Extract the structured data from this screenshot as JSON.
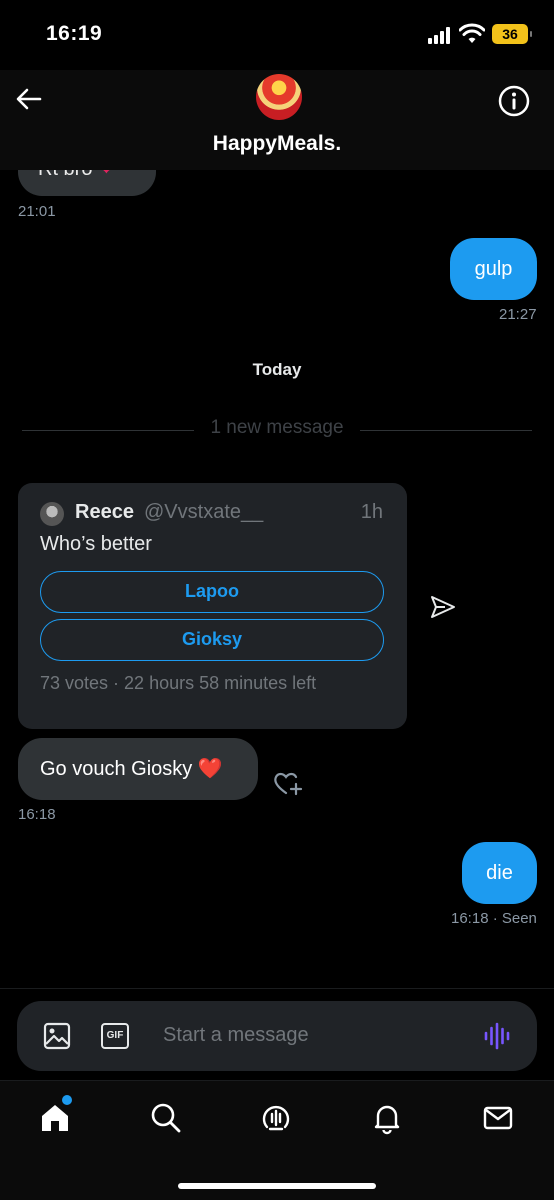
{
  "status_bar": {
    "time": "16:19",
    "battery": "36"
  },
  "header": {
    "title": "HappyMeals."
  },
  "messages": {
    "partial_text": "Rt bro",
    "partial_time": "21:01",
    "gulp": "gulp",
    "gulp_time": "21:27",
    "today_label": "Today",
    "new_message_label": "1 new message",
    "poll": {
      "author_name": "Reece",
      "author_handle": "@Vvstxate__",
      "age": "1h",
      "question": "Who’s better",
      "options": [
        "Lapoo",
        "Gioksy"
      ],
      "meta": "73 votes · 22 hours 58 minutes left"
    },
    "vouch": "Go vouch Giosky ❤️",
    "vouch_time": "16:18",
    "die": "die",
    "die_time": "16:18 · Seen"
  },
  "composer": {
    "placeholder": "Start a message",
    "gif_label": "GIF"
  },
  "colors": {
    "accent": "#1d9bf0",
    "bubble_in": "#2f3336",
    "card": "#202327",
    "voice": "#7856ff"
  }
}
